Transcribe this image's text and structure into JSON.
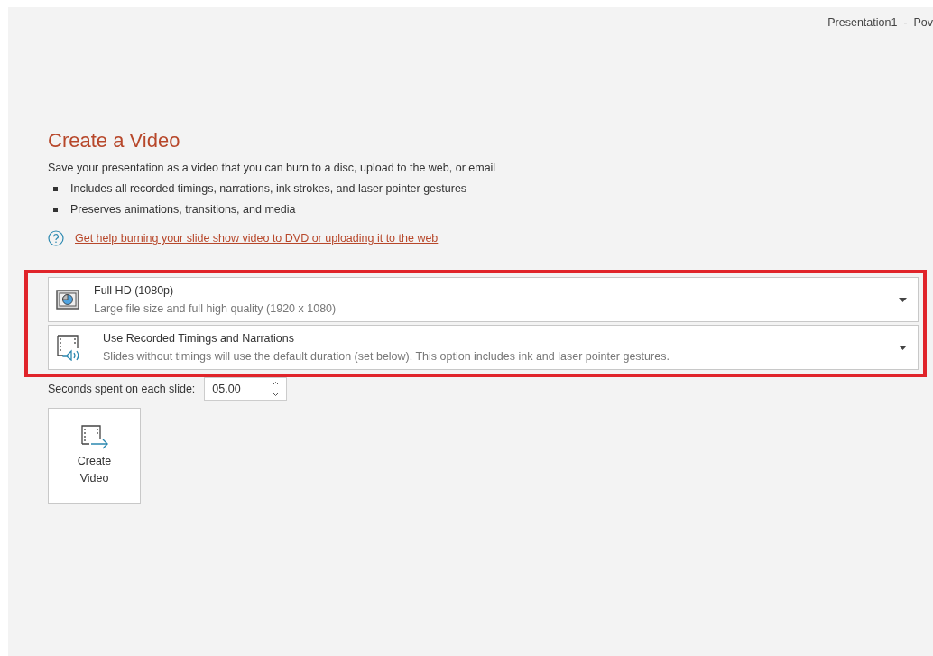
{
  "window": {
    "title": "Presentation1  -  Pov"
  },
  "heading": "Create a Video",
  "description": "Save your presentation as a video that you can burn to a disc, upload to the web, or email",
  "bullets": [
    "Includes all recorded timings, narrations, ink strokes, and laser pointer gestures",
    "Preserves animations, transitions, and media"
  ],
  "help_link": "Get help burning your slide show video to DVD or uploading it to the web",
  "highlighted": true,
  "dropdowns": [
    {
      "kind": "quality",
      "title": "Full HD (1080p)",
      "subtitle": "Large file size and full high quality (1920 x 1080)"
    },
    {
      "kind": "timings",
      "title": "Use Recorded Timings and Narrations",
      "subtitle": "Slides without timings will use the default duration (set below). This option includes ink and laser pointer gestures."
    }
  ],
  "seconds": {
    "label": "Seconds spent on each slide:",
    "value": "05.00"
  },
  "create_button": {
    "line_1": "Create",
    "line_2": "Video"
  }
}
